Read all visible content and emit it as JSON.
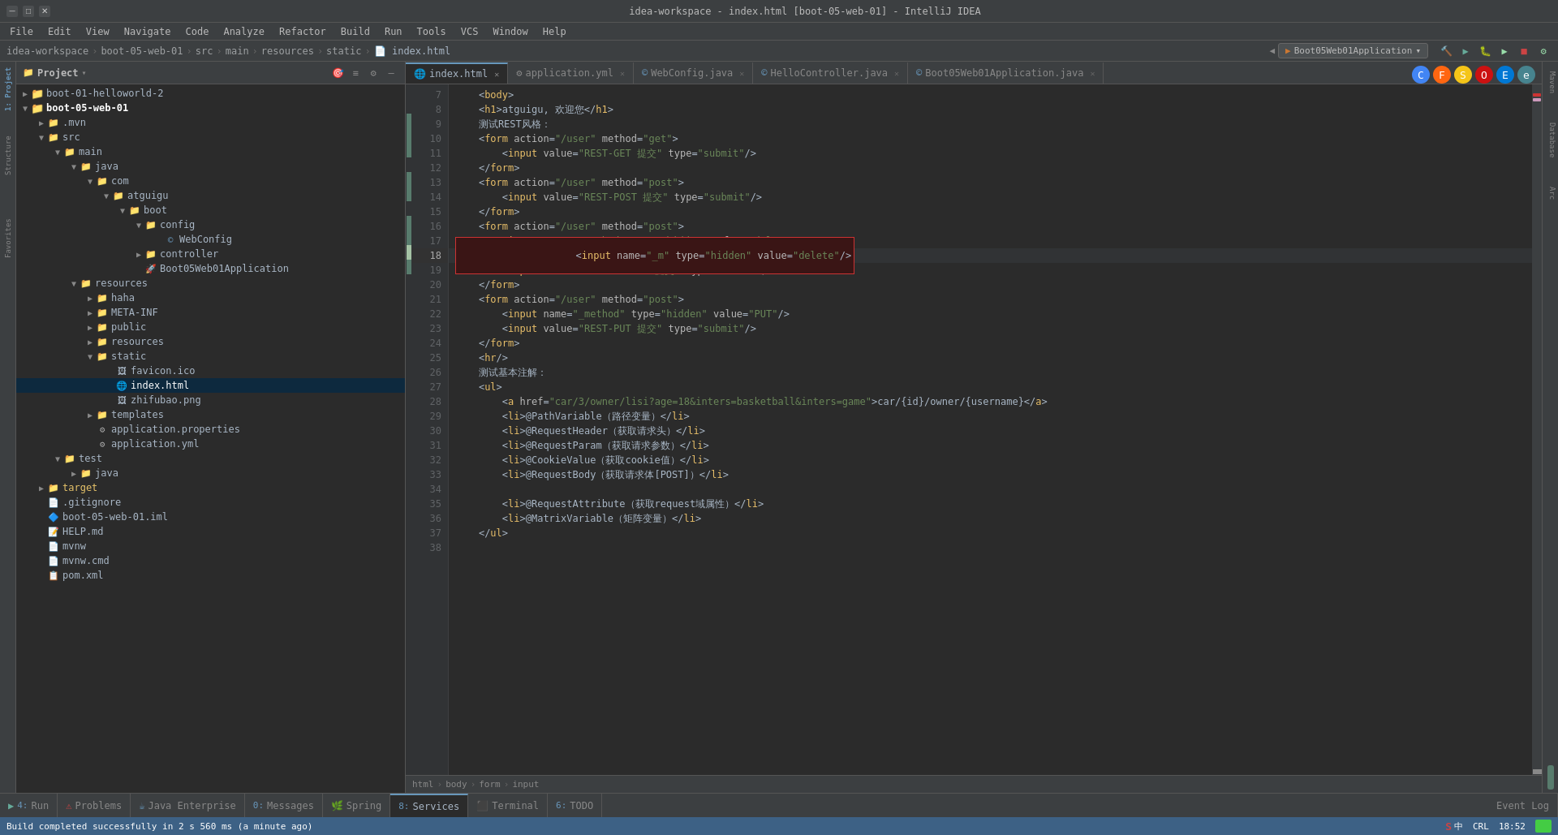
{
  "window": {
    "title": "idea-workspace - index.html [boot-05-web-01] - IntelliJ IDEA",
    "min_btn": "─",
    "max_btn": "□",
    "close_btn": "✕"
  },
  "menu": {
    "items": [
      "File",
      "Edit",
      "View",
      "Navigate",
      "Code",
      "Analyze",
      "Refactor",
      "Build",
      "Run",
      "Tools",
      "VCS",
      "Window",
      "Help"
    ]
  },
  "breadcrumb": {
    "items": [
      "idea-workspace",
      "boot-05-web-01",
      "src",
      "main",
      "resources",
      "static",
      "index.html"
    ],
    "run_config": "Boot05Web01Application"
  },
  "project_panel": {
    "title": "Project",
    "tree": [
      {
        "level": 0,
        "type": "folder",
        "name": "boot-01-helloworld-2",
        "expanded": true
      },
      {
        "level": 0,
        "type": "folder",
        "name": "boot-05-web-01",
        "expanded": true,
        "bold": true
      },
      {
        "level": 1,
        "type": "folder",
        "name": ".mvn"
      },
      {
        "level": 1,
        "type": "folder",
        "name": "src",
        "expanded": true
      },
      {
        "level": 2,
        "type": "folder",
        "name": "main",
        "expanded": true
      },
      {
        "level": 3,
        "type": "folder",
        "name": "java",
        "expanded": true
      },
      {
        "level": 4,
        "type": "folder",
        "name": "com",
        "expanded": true
      },
      {
        "level": 5,
        "type": "folder",
        "name": "atguigu",
        "expanded": true
      },
      {
        "level": 6,
        "type": "folder",
        "name": "boot",
        "expanded": true
      },
      {
        "level": 7,
        "type": "folder",
        "name": "config",
        "expanded": true
      },
      {
        "level": 8,
        "type": "class",
        "name": "WebConfig"
      },
      {
        "level": 7,
        "type": "folder",
        "name": "controller"
      },
      {
        "level": 7,
        "type": "class",
        "name": "Boot05Web01Application"
      },
      {
        "level": 3,
        "type": "folder",
        "name": "resources",
        "expanded": true
      },
      {
        "level": 4,
        "type": "folder",
        "name": "haha"
      },
      {
        "level": 4,
        "type": "folder",
        "name": "META-INF"
      },
      {
        "level": 4,
        "type": "folder",
        "name": "public"
      },
      {
        "level": 4,
        "type": "folder",
        "name": "resources"
      },
      {
        "level": 4,
        "type": "folder",
        "name": "static",
        "expanded": true
      },
      {
        "level": 5,
        "type": "file",
        "name": "favicon.ico"
      },
      {
        "level": 5,
        "type": "html",
        "name": "index.html",
        "selected": true
      },
      {
        "level": 5,
        "type": "file",
        "name": "zhifubao.png"
      },
      {
        "level": 4,
        "type": "folder",
        "name": "templates"
      },
      {
        "level": 4,
        "type": "props",
        "name": "application.properties"
      },
      {
        "level": 4,
        "type": "yaml",
        "name": "application.yml"
      },
      {
        "level": 2,
        "type": "folder",
        "name": "test",
        "expanded": true
      },
      {
        "level": 3,
        "type": "folder",
        "name": "java"
      },
      {
        "level": 1,
        "type": "folder",
        "name": "target",
        "bold_yellow": true
      },
      {
        "level": 1,
        "type": "file",
        "name": ".gitignore"
      },
      {
        "level": 1,
        "type": "iml",
        "name": "boot-05-web-01.iml"
      },
      {
        "level": 1,
        "type": "md",
        "name": "HELP.md"
      },
      {
        "level": 1,
        "type": "file",
        "name": "mvnw"
      },
      {
        "level": 1,
        "type": "cmd",
        "name": "mvnw.cmd"
      },
      {
        "level": 1,
        "type": "xml",
        "name": "pom.xml"
      }
    ]
  },
  "editor_tabs": [
    {
      "name": "index.html",
      "active": true,
      "modified": false,
      "icon": "html"
    },
    {
      "name": "application.yml",
      "active": false,
      "modified": false,
      "icon": "yaml"
    },
    {
      "name": "WebConfig.java",
      "active": false,
      "modified": false,
      "icon": "java"
    },
    {
      "name": "HelloController.java",
      "active": false,
      "modified": false,
      "icon": "java"
    },
    {
      "name": "Boot05Web01Application.java",
      "active": false,
      "modified": false,
      "icon": "java"
    }
  ],
  "browser_icons": [
    "🔵",
    "🟠",
    "🟡",
    "🔴",
    "🔷",
    "🔵"
  ],
  "code_lines": [
    {
      "num": 7,
      "content": "    <body>",
      "type": "normal"
    },
    {
      "num": 8,
      "content": "    <h1>atguigu, 欢迎您</h1>",
      "type": "normal"
    },
    {
      "num": 9,
      "content": "    测试REST风格：",
      "type": "normal"
    },
    {
      "num": 10,
      "content": "    <form action=\"/user\" method=\"get\">",
      "type": "normal"
    },
    {
      "num": 11,
      "content": "        <input value=\"REST-GET 提交\" type=\"submit\"/>",
      "type": "normal"
    },
    {
      "num": 12,
      "content": "    </form>",
      "type": "normal"
    },
    {
      "num": 13,
      "content": "    <form action=\"/user\" method=\"post\">",
      "type": "normal"
    },
    {
      "num": 14,
      "content": "        <input value=\"REST-POST 提交\" type=\"submit\"/>",
      "type": "normal"
    },
    {
      "num": 15,
      "content": "    </form>",
      "type": "normal"
    },
    {
      "num": 16,
      "content": "    <form action=\"/user\" method=\"post\">",
      "type": "normal"
    },
    {
      "num": 17,
      "content": "        <input name=\"_method\" type=\"hidden\" value=\"delete\"/>",
      "type": "normal"
    },
    {
      "num": 18,
      "content": "        <input name=\"_m\" type=\"hidden\" value=\"delete\"/>",
      "type": "error"
    },
    {
      "num": 19,
      "content": "        <input value=\"REST-DELETE 提交\" type=\"submit\"/>",
      "type": "normal"
    },
    {
      "num": 20,
      "content": "    </form>",
      "type": "normal"
    },
    {
      "num": 21,
      "content": "    <form action=\"/user\" method=\"post\">",
      "type": "normal"
    },
    {
      "num": 22,
      "content": "        <input name=\"_method\" type=\"hidden\" value=\"PUT\"/>",
      "type": "normal"
    },
    {
      "num": 23,
      "content": "        <input value=\"REST-PUT 提交\" type=\"submit\"/>",
      "type": "normal"
    },
    {
      "num": 24,
      "content": "    </form>",
      "type": "normal"
    },
    {
      "num": 25,
      "content": "    <hr/>",
      "type": "normal"
    },
    {
      "num": 26,
      "content": "    测试基本注解：",
      "type": "normal"
    },
    {
      "num": 27,
      "content": "    <ul>",
      "type": "normal"
    },
    {
      "num": 28,
      "content": "        <a href=\"car/3/owner/lisi?age=18&inters=basketball&inters=game\">car/{id}/owner/{username}</a>",
      "type": "normal"
    },
    {
      "num": 29,
      "content": "        <li>@PathVariable（路径变量）</li>",
      "type": "normal"
    },
    {
      "num": 30,
      "content": "        <li>@RequestHeader（获取请求头）</li>",
      "type": "normal"
    },
    {
      "num": 31,
      "content": "        <li>@RequestParam（获取请求参数）</li>",
      "type": "normal"
    },
    {
      "num": 32,
      "content": "        <li>@CookieValue（获取cookie值）</li>",
      "type": "normal"
    },
    {
      "num": 33,
      "content": "        <li>@RequestBody（获取请求体[POST]）</li>",
      "type": "normal"
    },
    {
      "num": 34,
      "content": "",
      "type": "normal"
    },
    {
      "num": 35,
      "content": "        <li>@RequestAttribute（获取request域属性）</li>",
      "type": "normal"
    },
    {
      "num": 36,
      "content": "        <li>@MatrixVariable（矩阵变量）</li>",
      "type": "normal"
    },
    {
      "num": 37,
      "content": "    </ul>",
      "type": "normal"
    },
    {
      "num": 38,
      "content": "",
      "type": "normal"
    }
  ],
  "path_bar": {
    "items": [
      "html",
      "body",
      "form",
      "input"
    ]
  },
  "bottom_tabs": [
    {
      "num": "4:",
      "name": "Run",
      "active": false
    },
    {
      "num": "",
      "name": "Problems",
      "active": false
    },
    {
      "num": "",
      "name": "Java Enterprise",
      "active": false
    },
    {
      "num": "0:",
      "name": "Messages",
      "active": false
    },
    {
      "num": "",
      "name": "Spring",
      "active": false
    },
    {
      "num": "8:",
      "name": "Services",
      "active": true
    },
    {
      "num": "",
      "name": "Terminal",
      "active": false
    },
    {
      "num": "6:",
      "name": "TODO",
      "active": false
    }
  ],
  "status_bar": {
    "message": "Build completed successfully in 2 s 560 ms (a minute ago)",
    "time": "18:52",
    "encoding": "CRL",
    "lang": "中",
    "indent": "4",
    "cursor": ""
  },
  "right_sidebar_tabs": [
    "Maven",
    "Database",
    "Arc"
  ],
  "colors": {
    "bg": "#2b2b2b",
    "panel_bg": "#3c3f41",
    "accent": "#6897bb",
    "error": "#cc0000",
    "selected": "#214283",
    "status_bg": "#3d6185"
  }
}
